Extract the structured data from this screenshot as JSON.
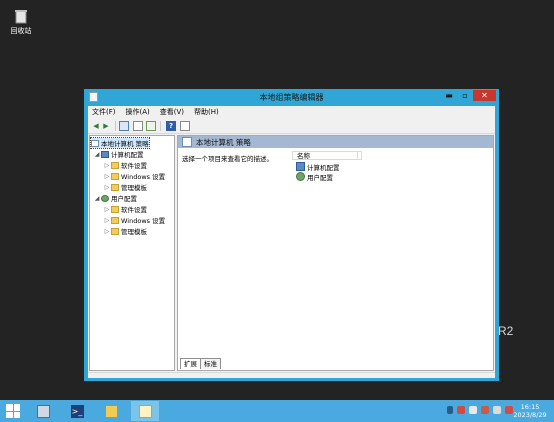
{
  "desktop": {
    "recycle_bin_label": "回收站",
    "watermark_text": "R2"
  },
  "window": {
    "title": "本地组策略编辑器",
    "controls": {
      "minimize": "▬",
      "maximize": "▫",
      "close": "✕"
    }
  },
  "menu": [
    "文件(F)",
    "操作(A)",
    "查看(V)",
    "帮助(H)"
  ],
  "toolbar": {
    "back_icon": "◀",
    "forward_icon": "▶",
    "help_label": "?"
  },
  "tree": {
    "root": "本地计算机 策略",
    "computer_config": "计算机配置",
    "user_config": "用户配置",
    "software_settings": "软件设置",
    "windows_settings": "Windows 设置",
    "admin_templates": "管理模板",
    "expand_arrow": "▷",
    "collapse_arrow": "◢"
  },
  "right_pane": {
    "header": "本地计算机 策略",
    "description": "选择一个项目来查看它的描述。",
    "column_name": "名称",
    "items": [
      "计算机配置",
      "用户配置"
    ]
  },
  "tabs": [
    "扩展",
    "标准"
  ],
  "taskbar": {
    "time": "16:15",
    "date": "2023/8/29",
    "powershell_glyph": ">_"
  },
  "colors": {
    "window_frame": "#2fa6d6",
    "taskbar": "#4aa9de",
    "desktop": "#232323",
    "close_button": "#c7372f",
    "pane_header": "#a4b8d4"
  }
}
